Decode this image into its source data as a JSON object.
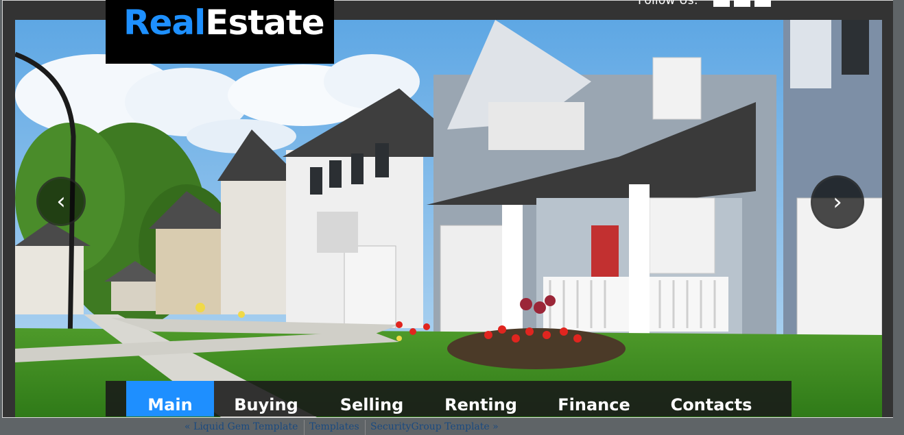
{
  "header": {
    "logo_part1": "Real",
    "logo_part2": "Estate",
    "follow_text": "Follow Us:"
  },
  "slider": {
    "prev_glyph": "‹",
    "next_glyph": "›"
  },
  "nav": {
    "items": [
      {
        "label": "Main",
        "active": true
      },
      {
        "label": "Buying",
        "active": false
      },
      {
        "label": "Selling",
        "active": false
      },
      {
        "label": "Renting",
        "active": false
      },
      {
        "label": "Finance",
        "active": false
      },
      {
        "label": "Contacts",
        "active": false
      }
    ]
  },
  "footer": {
    "prev_link": "« Liquid Gem Template",
    "templates_link": "Templates",
    "next_link": "SecurityGroup Template »"
  },
  "colors": {
    "accent": "#1e8fff",
    "frame": "#333333",
    "page_bg": "#5f6467",
    "link": "#1a4a80"
  }
}
